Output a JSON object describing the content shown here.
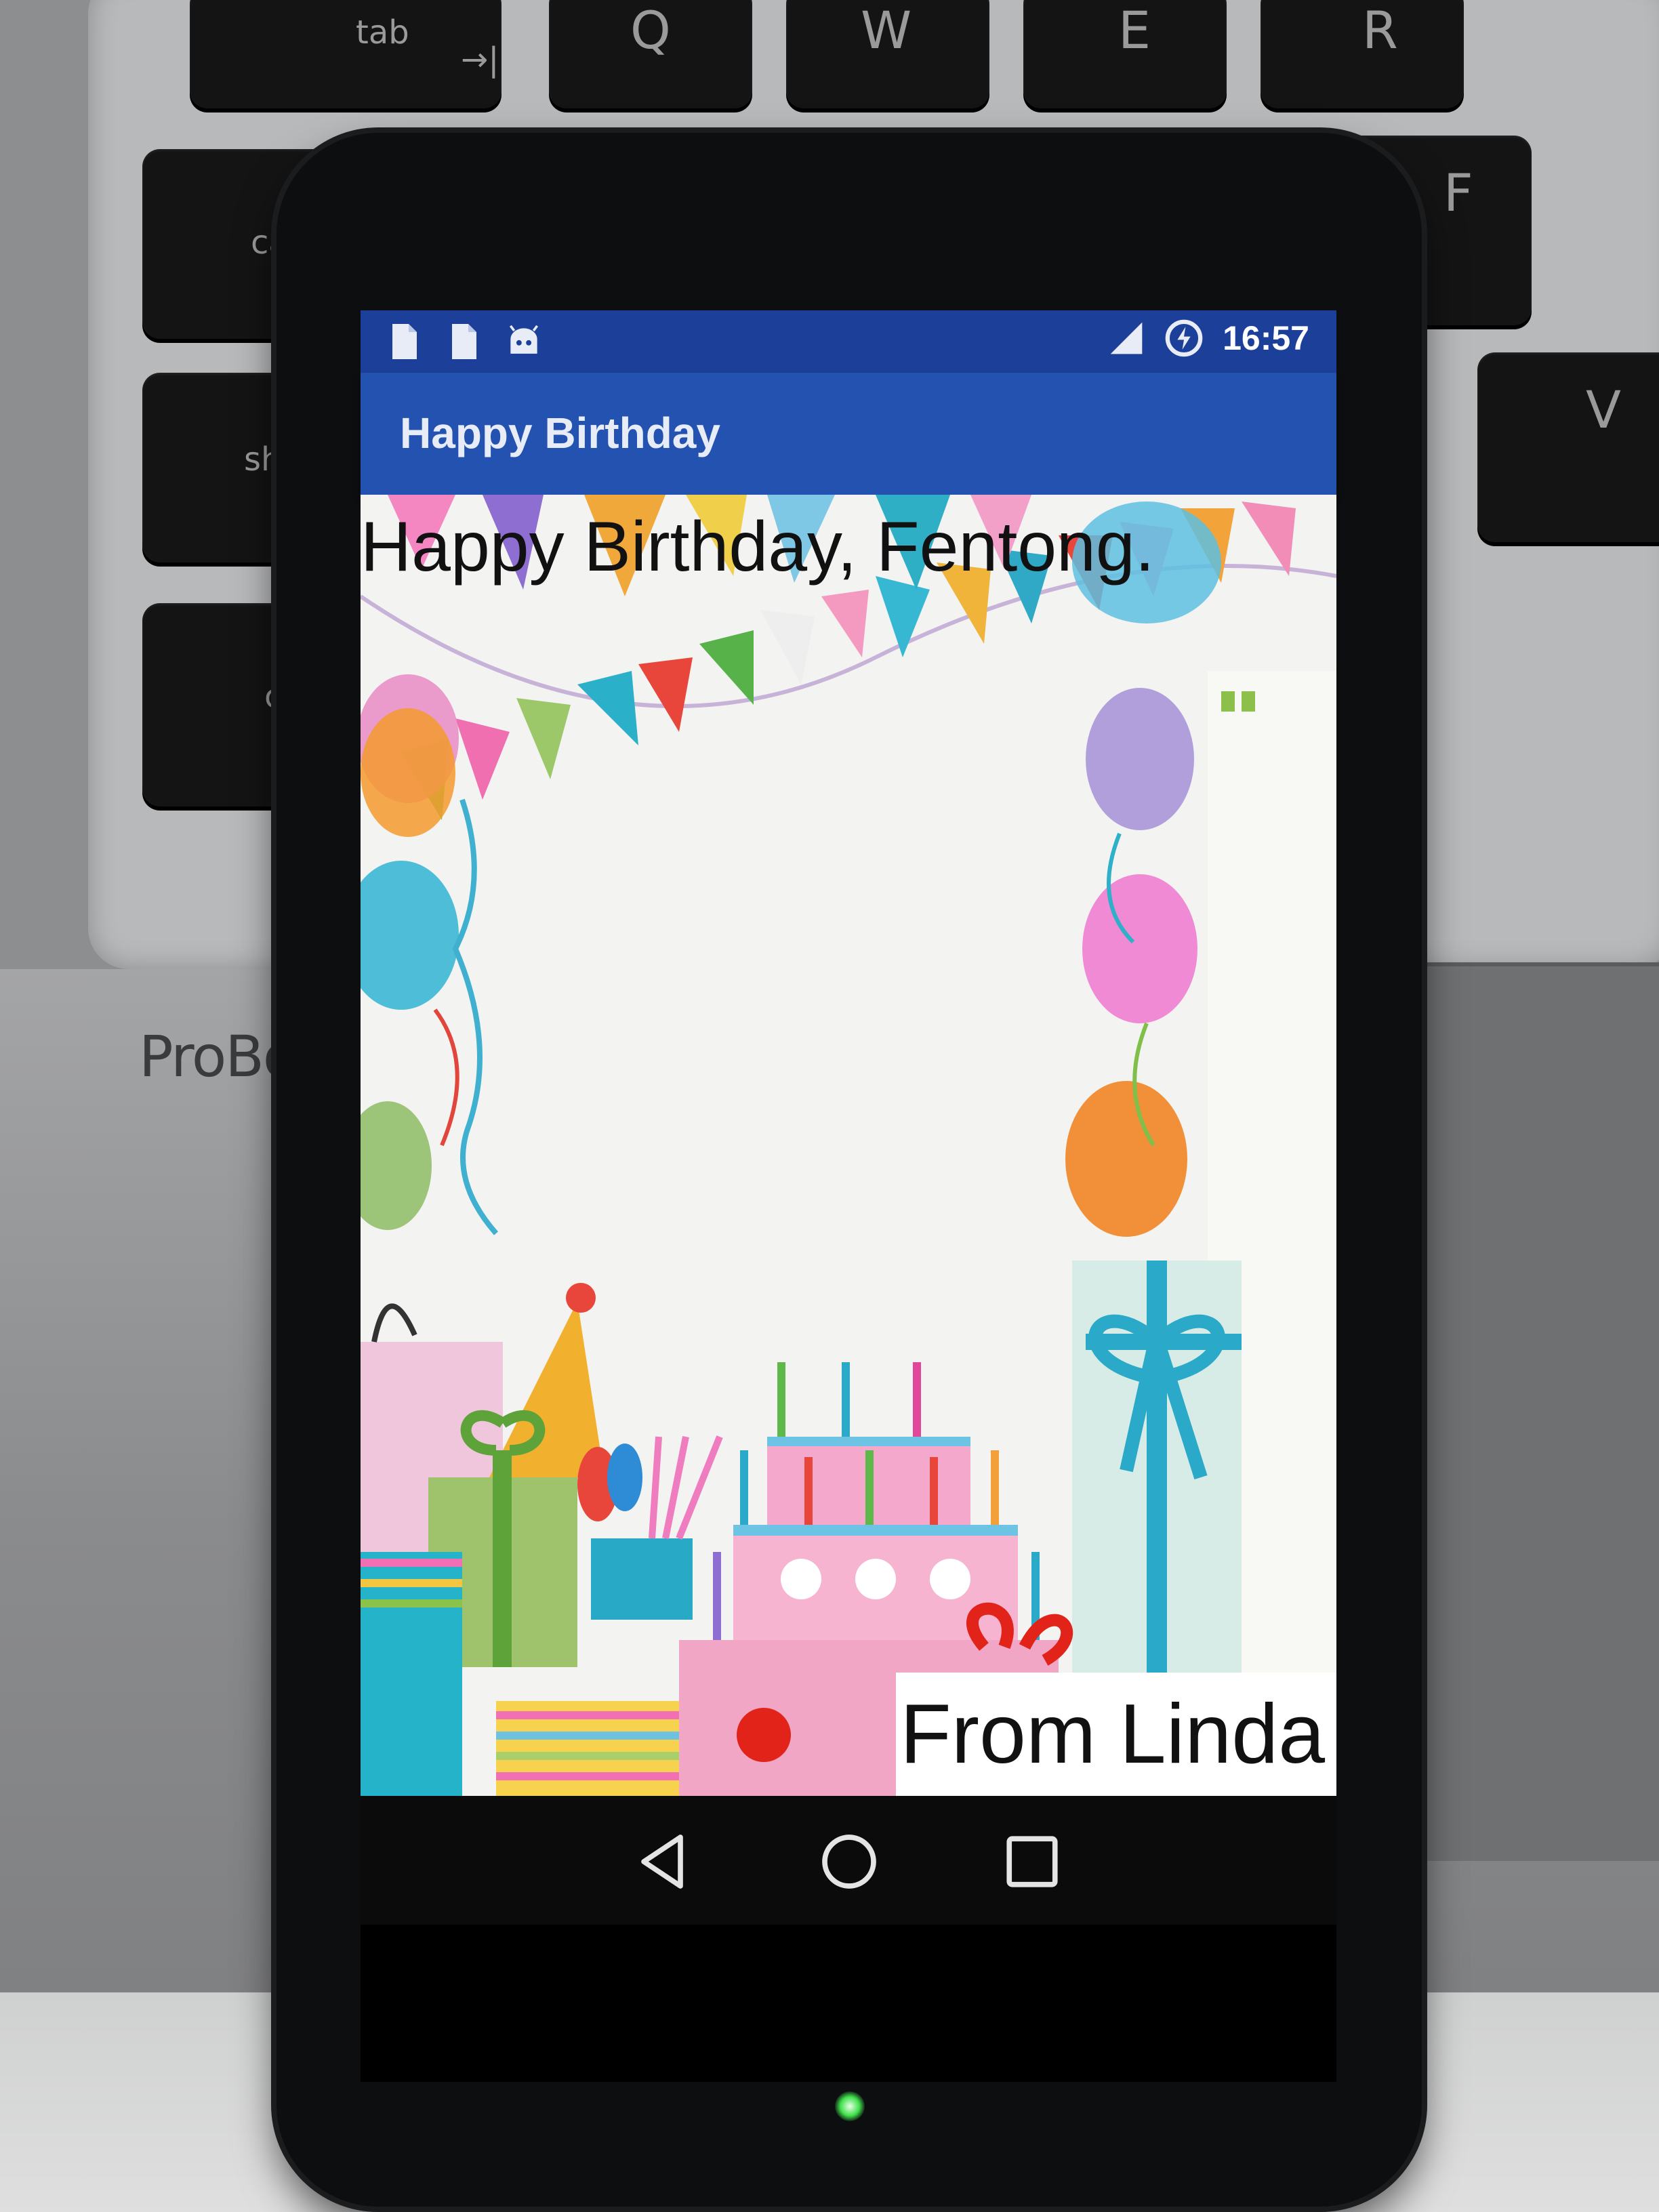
{
  "status_bar": {
    "time": "16:57",
    "left_icons": [
      "file-icon",
      "file-icon",
      "android-debug-icon"
    ],
    "right_icons": [
      "signal-icon",
      "battery-saver-icon"
    ]
  },
  "app_bar": {
    "title": "Happy Birthday"
  },
  "card": {
    "greeting": "Happy Birthday, Fentong.",
    "signature": "From Linda"
  },
  "nav_bar": {
    "buttons": [
      "back-icon",
      "home-icon",
      "recents-icon"
    ]
  },
  "background": {
    "keyboard_keys": [
      "tab",
      "Q",
      "W",
      "E",
      "R",
      "caps",
      "F",
      "shift",
      "V",
      "ctrl"
    ],
    "laptop_brand": "ProBoo"
  },
  "colors": {
    "status_bar": "#1c3f9a",
    "app_bar": "#2352b0",
    "card_background": "#f3f3f2"
  }
}
